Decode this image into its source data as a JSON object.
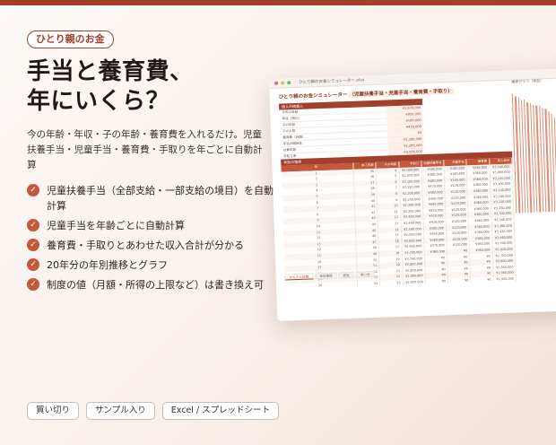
{
  "tag": "ひとり親のお金",
  "headline_line1": "手当と養育費、",
  "headline_line2": "年にいくら？",
  "description": "今の年齢・年収・子の年齢・養育費を入れるだけ。児童扶養手当・児童手当・養育費・手取りを年ごとに自動計算",
  "features": [
    "児童扶養手当（全部支給・一部支給の境目）を自動計算",
    "児童手当を年齢ごとに自動計算",
    "養育費・手取りとあわせた収入合計が分かる",
    "20年分の年別推移とグラフ",
    "制度の値（月額・所得の上限など）は書き換え可"
  ],
  "pills": [
    "買い切り",
    "サンプル入り",
    "Excel / スプレッドシート"
  ],
  "colors": {
    "accent": "#a3402c",
    "accent_light": "#c4583d",
    "check": "#c4583d"
  },
  "sheet": {
    "window_title": "ひとり親のお金シミュレーター.xlsx",
    "title_prefix": "ひとり親のお金シミュレーター",
    "title_highlight": "（児童扶養手当・児童手当・養育費・手取り）",
    "input_header": "個人の情報入",
    "input_rows": [
      {
        "label": "今年の年齢",
        "value": "¥1,870,000"
      },
      {
        "label": "年収（税込）",
        "value": "¥950,000"
      },
      {
        "label": "子の年齢",
        "value": "¥180,000"
      },
      {
        "label": "子の人数",
        "value": "¥478,000"
      },
      {
        "label": "養育費（月額）",
        "value": "¥0"
      },
      {
        "label": "手当の開始年",
        "value": "¥2,200,000"
      },
      {
        "label": "計算年数",
        "value": "¥2,200,000"
      },
      {
        "label": "手取り率",
        "value": "¥3,500,000"
      },
      {
        "label": "扶養人数",
        "value": "¥3,500,000"
      }
    ],
    "graph_label": "推移グラフ（年別）",
    "graph_levels": [
      0.95,
      0.93,
      0.92,
      0.9,
      0.9,
      0.88,
      0.87,
      0.86,
      0.85,
      0.85,
      0.83,
      0.82,
      0.8,
      0.78,
      0.75,
      0.7,
      0.62,
      0.5,
      0.4,
      0.3
    ],
    "table_title": "年別の推移",
    "table_headers": [
      "年",
      "本人年齢",
      "子の年齢",
      "手取り",
      "児童扶養手当",
      "児童手当",
      "養育費",
      "収入合計"
    ],
    "table_rows": [
      [
        "1",
        "35",
        "4",
        "¥2,000,000",
        "¥500,000",
        "¥180,000",
        "¥360,000",
        "¥3,040,000"
      ],
      [
        "2",
        "36",
        "5",
        "¥2,050,000",
        "¥490,000",
        "¥180,000",
        "¥360,000",
        "¥3,080,000"
      ],
      [
        "3",
        "37",
        "6",
        "¥2,100,000",
        "¥480,000",
        "¥180,000",
        "¥360,000",
        "¥3,120,000"
      ],
      [
        "4",
        "38",
        "7",
        "¥2,150,000",
        "¥470,000",
        "¥120,000",
        "¥360,000",
        "¥3,100,000"
      ],
      [
        "5",
        "39",
        "8",
        "¥2,200,000",
        "¥460,000",
        "¥120,000",
        "¥360,000",
        "¥3,140,000"
      ],
      [
        "6",
        "40",
        "9",
        "¥2,250,000",
        "¥450,000",
        "¥120,000",
        "¥360,000",
        "¥3,180,000"
      ],
      [
        "7",
        "41",
        "10",
        "¥2,300,000",
        "¥440,000",
        "¥120,000",
        "¥360,000",
        "¥3,220,000"
      ],
      [
        "8",
        "42",
        "11",
        "¥2,350,000",
        "¥430,000",
        "¥120,000",
        "¥360,000",
        "¥3,260,000"
      ],
      [
        "9",
        "43",
        "12",
        "¥2,400,000",
        "¥420,000",
        "¥120,000",
        "¥360,000",
        "¥3,300,000"
      ],
      [
        "10",
        "44",
        "13",
        "¥2,450,000",
        "¥410,000",
        "¥120,000",
        "¥360,000",
        "¥3,340,000"
      ],
      [
        "11",
        "45",
        "14",
        "¥2,500,000",
        "¥400,000",
        "¥120,000",
        "¥360,000",
        "¥3,380,000"
      ],
      [
        "12",
        "46",
        "15",
        "¥2,550,000",
        "¥390,000",
        "¥120,000",
        "¥360,000",
        "¥3,420,000"
      ],
      [
        "13",
        "47",
        "16",
        "¥2,600,000",
        "¥380,000",
        "¥120,000",
        "¥360,000",
        "¥3,460,000"
      ],
      [
        "14",
        "48",
        "17",
        "¥2,650,000",
        "¥370,000",
        "¥120,000",
        "¥360,000",
        "¥3,500,000"
      ],
      [
        "15",
        "49",
        "18",
        "¥2,700,000",
        "¥360,000",
        "¥0",
        "¥360,000",
        "¥3,420,000"
      ],
      [
        "16",
        "50",
        "19",
        "¥2,750,000",
        "¥0",
        "¥0",
        "¥0",
        "¥2,750,000"
      ],
      [
        "17",
        "51",
        "20",
        "¥2,800,000",
        "¥0",
        "¥0",
        "¥0",
        "¥2,800,000"
      ],
      [
        "18",
        "52",
        "21",
        "¥2,850,000",
        "¥0",
        "¥0",
        "¥0",
        "¥2,850,000"
      ],
      [
        "19",
        "53",
        "22",
        "¥2,900,000",
        "¥0",
        "¥0",
        "¥0",
        "¥2,900,000"
      ],
      [
        "20",
        "54",
        "23",
        "¥2,950,000",
        "¥0",
        "¥0",
        "¥0",
        "¥2,950,000"
      ]
    ],
    "tabs": [
      "かんたん計算",
      "年別推移",
      "設定",
      "使い方"
    ]
  }
}
